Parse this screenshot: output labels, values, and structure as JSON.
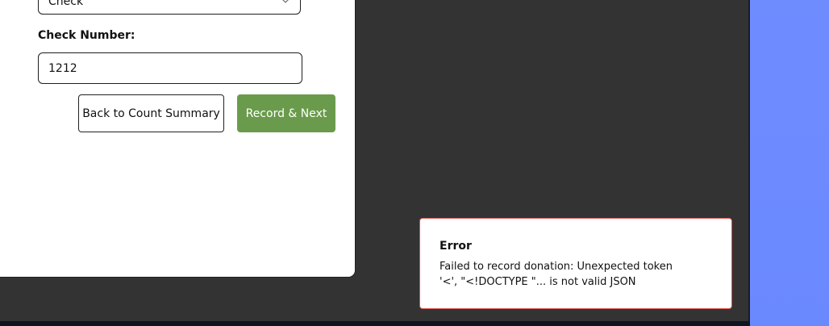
{
  "form": {
    "payment_method": {
      "selected_value": "Check"
    },
    "check_number": {
      "label": "Check Number:",
      "value": "1212"
    },
    "buttons": {
      "back_label": "Back to Count Summary",
      "record_next_label": "Record & Next"
    }
  },
  "toast": {
    "title": "Error",
    "message": "Failed to record donation: Unexpected token '<', \"<!DOCTYPE \"... is not valid JSON",
    "border_color": "#d9534f"
  },
  "colors": {
    "background": "#333333",
    "accent_band": "#6f8cff",
    "primary_button": "#6a9b4c"
  },
  "icons": {
    "select_chevron": "chevron-down-icon"
  }
}
